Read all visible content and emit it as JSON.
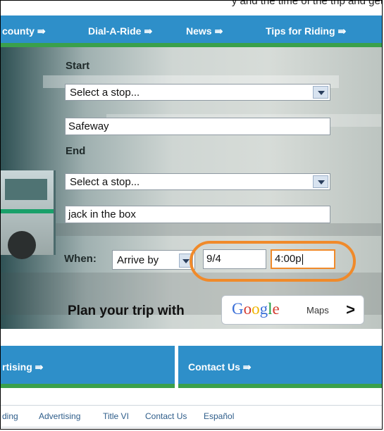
{
  "top_clip": "y and the time of the trip and get",
  "nav": {
    "items": [
      {
        "label": "county",
        "arrow": "⇛"
      },
      {
        "label": "Dial-A-Ride",
        "arrow": "⇛"
      },
      {
        "label": "News",
        "arrow": "⇛"
      },
      {
        "label": "Tips for Riding",
        "arrow": "⇛"
      }
    ]
  },
  "planner": {
    "start_label": "Start",
    "start_select": "Select a stop...",
    "start_input": "Safeway",
    "end_label": "End",
    "end_select": "Select a stop...",
    "end_input": "jack in the box",
    "when_label": "When:",
    "when_select": "Arrive by",
    "date_value": "9/4",
    "time_value": "4:00p",
    "plan_label": "Plan your trip with",
    "google_maps_label": "Maps",
    "google_logo_text": "Google"
  },
  "footer": {
    "left_box": {
      "label": "rtising",
      "arrow": "⇛"
    },
    "right_box": {
      "label": "Contact Us",
      "arrow": "⇛"
    },
    "links": [
      "ding",
      "Advertising",
      "Title VI",
      "Contact Us",
      "Español"
    ]
  },
  "colors": {
    "nav_blue": "#2e8fc9",
    "nav_green": "#3aa04b",
    "highlight_orange": "#f08a2a"
  }
}
